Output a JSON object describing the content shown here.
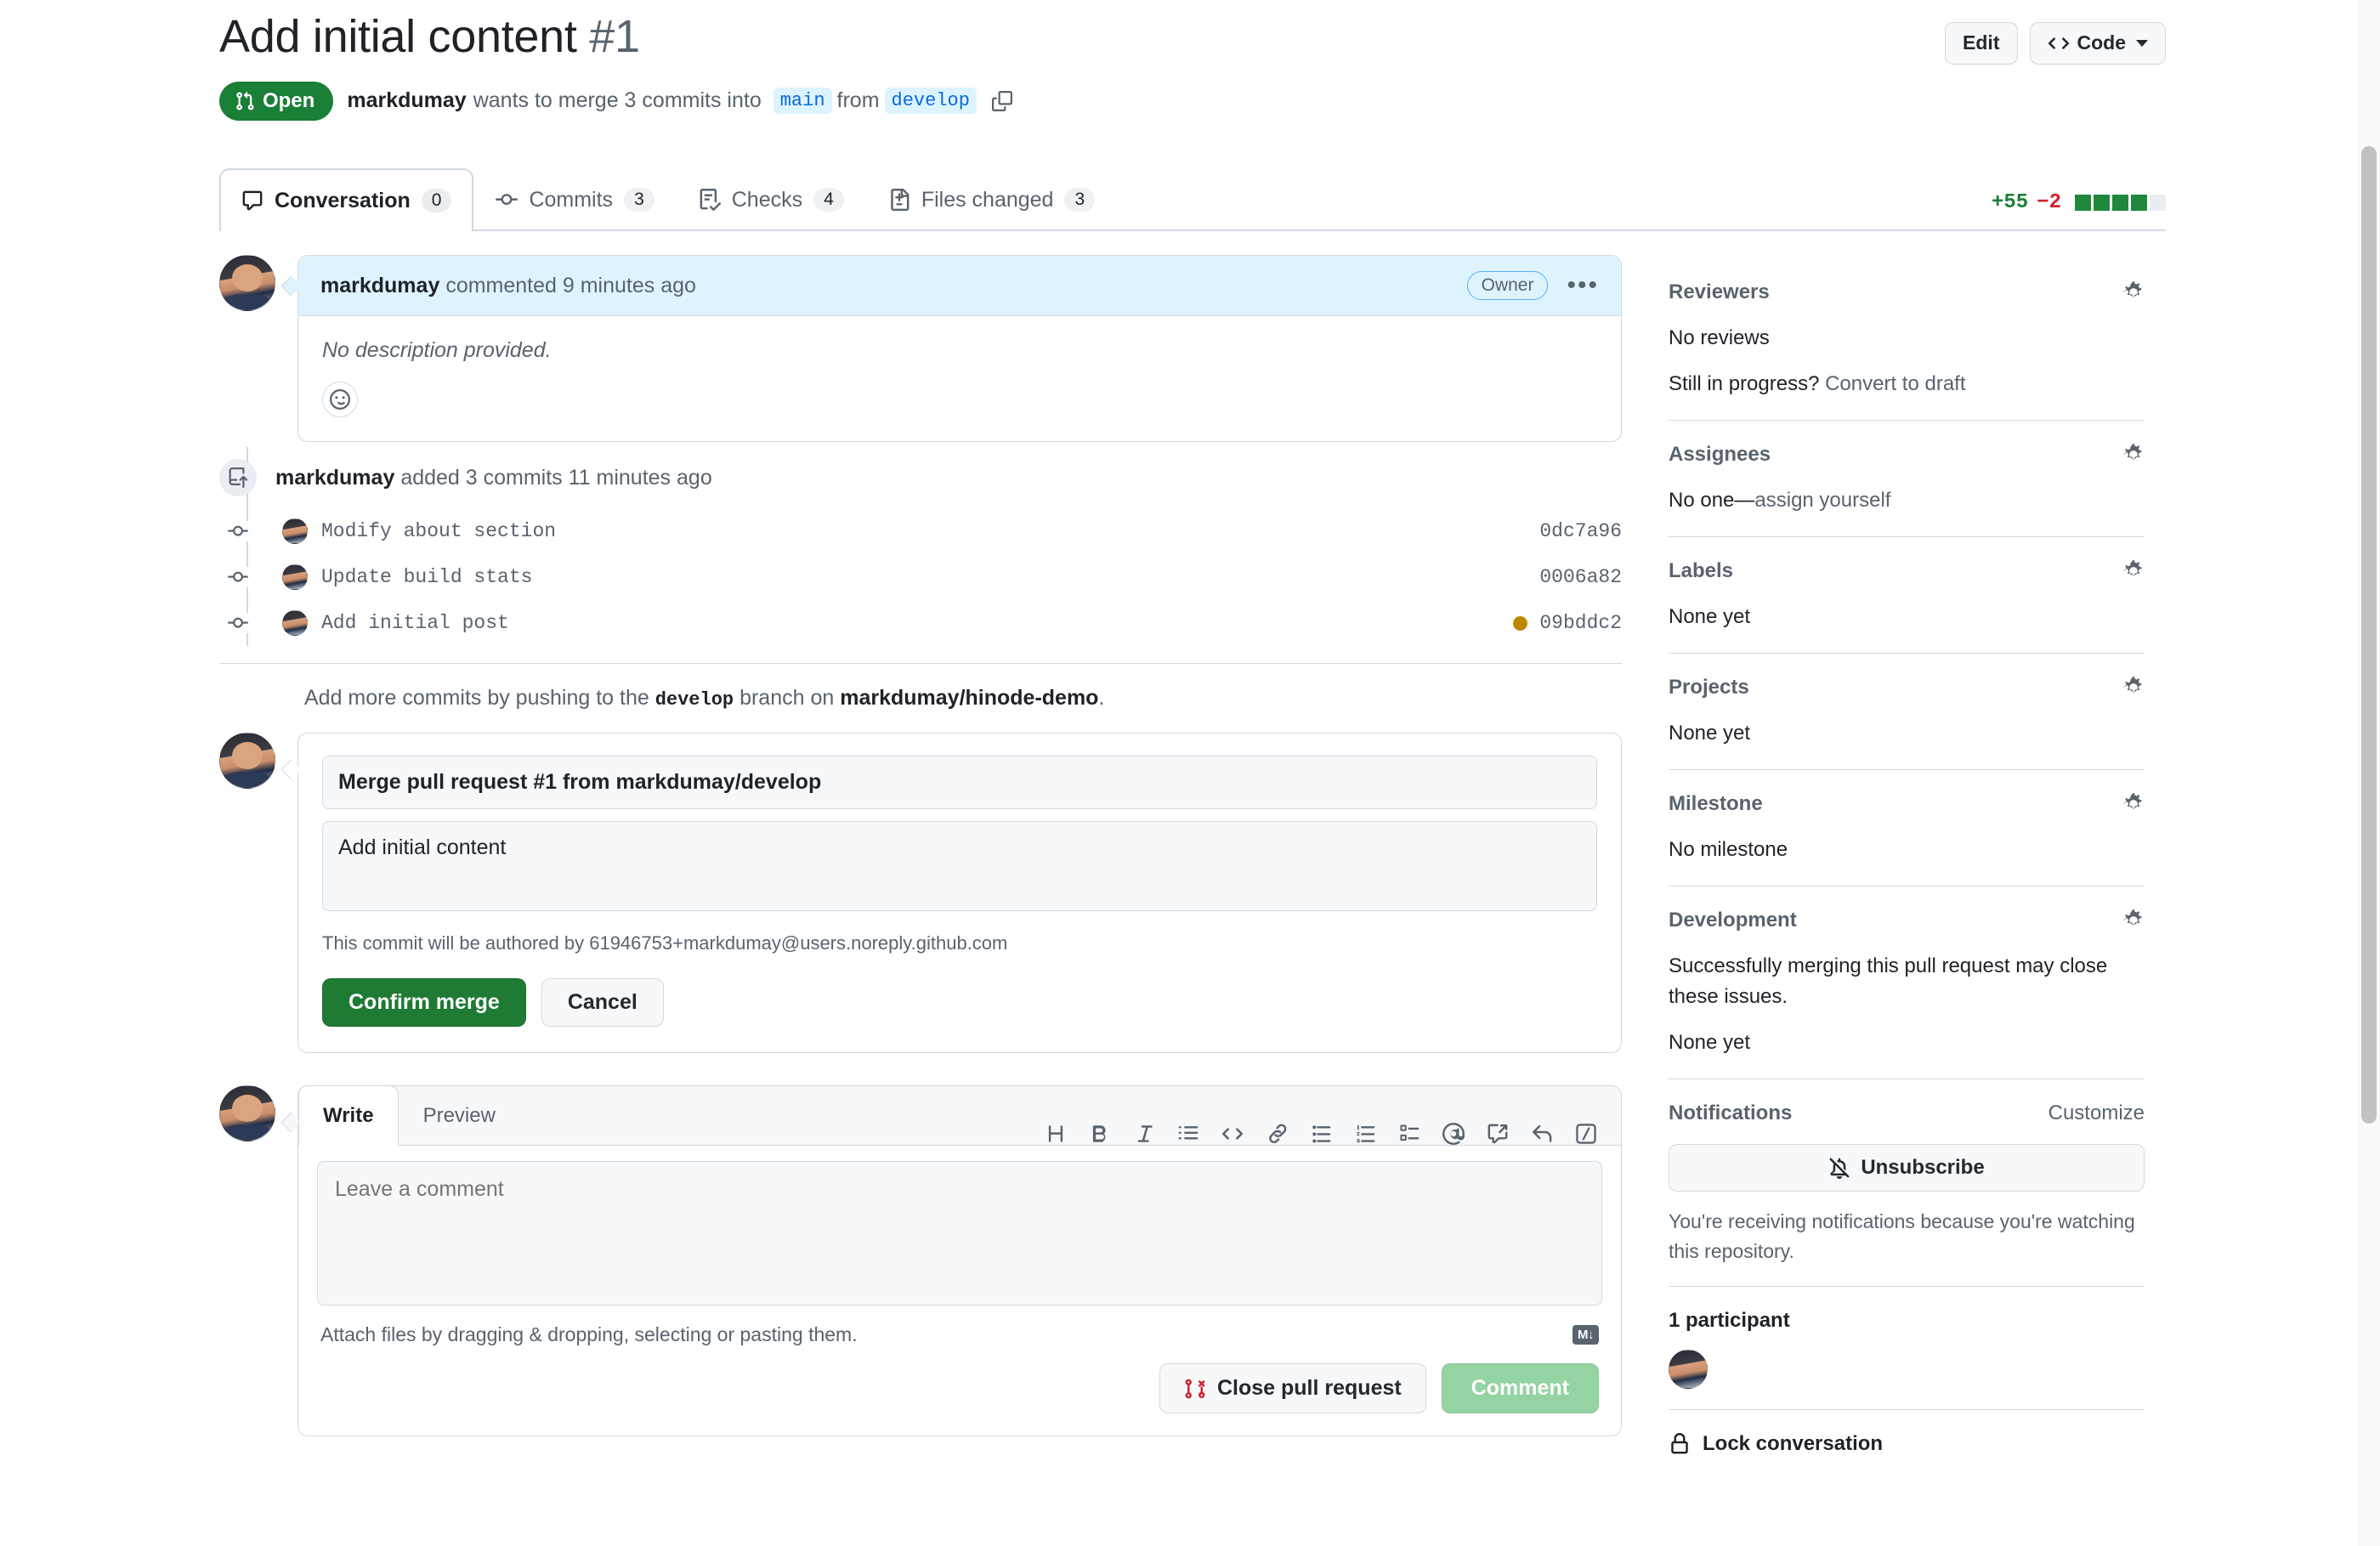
{
  "header": {
    "title": "Add initial content",
    "number": "#1",
    "edit_label": "Edit",
    "code_label": "Code",
    "state": "Open",
    "author": "markdumay",
    "merge_text_1": "wants to merge 3 commits into",
    "base_branch": "main",
    "merge_text_2": "from",
    "head_branch": "develop"
  },
  "tabs": [
    {
      "label": "Conversation",
      "count": "0",
      "icon": "comment-icon",
      "active": true
    },
    {
      "label": "Commits",
      "count": "3",
      "icon": "commit-icon",
      "active": false
    },
    {
      "label": "Checks",
      "count": "4",
      "icon": "checklist-icon",
      "active": false
    },
    {
      "label": "Files changed",
      "count": "3",
      "icon": "file-diff-icon",
      "active": false
    }
  ],
  "diffstat": {
    "additions": "+55",
    "deletions": "−2",
    "blocks": [
      "g",
      "g",
      "g",
      "g",
      "n"
    ],
    "add_color": "#1a7f37",
    "del_color": "#cf222e"
  },
  "comment": {
    "author": "markdumay",
    "action": "commented 9 minutes ago",
    "role_badge": "Owner",
    "body": "No description provided.",
    "header_bg": "#ddf4ff"
  },
  "timeline": {
    "push_author": "markdumay",
    "push_action": "added 3 commits 11 minutes ago",
    "commits": [
      {
        "message": "Modify about section",
        "sha": "0dc7a96",
        "status": ""
      },
      {
        "message": "Update build stats",
        "sha": "0006a82",
        "status": ""
      },
      {
        "message": "Add initial post",
        "sha": "09bddc2",
        "status": "pending"
      }
    ],
    "status_pending_color": "#bf8700",
    "add_more_prefix": "Add more commits by pushing to the",
    "add_more_branch": "develop",
    "add_more_middle": "branch on",
    "add_more_repo": "markdumay/hinode-demo",
    "add_more_suffix": "."
  },
  "merge_form": {
    "commit_title": "Merge pull request #1 from markdumay/develop",
    "commit_description": "Add initial content",
    "authored_note": "This commit will be authored by 61946753+markdumay@users.noreply.github.com",
    "confirm_label": "Confirm merge",
    "cancel_label": "Cancel",
    "confirm_color": "#1f7a33"
  },
  "editor": {
    "write_tab": "Write",
    "preview_tab": "Preview",
    "placeholder": "Leave a comment",
    "attach_note": "Attach files by dragging & dropping, selecting or pasting them.",
    "markdown_badge": "M↓",
    "toolbar": [
      {
        "name": "heading-icon",
        "glyph": "H"
      },
      {
        "name": "bold-icon",
        "glyph": "B"
      },
      {
        "name": "italic-icon",
        "glyph": "I"
      },
      {
        "name": "quote-icon",
        "glyph": "”"
      },
      {
        "name": "code-icon",
        "glyph": "<>"
      },
      {
        "name": "link-icon",
        "glyph": "🔗"
      },
      {
        "name": "unordered-list-icon",
        "glyph": "☰"
      },
      {
        "name": "ordered-list-icon",
        "glyph": "☰"
      },
      {
        "name": "task-list-icon",
        "glyph": "☑"
      },
      {
        "name": "mention-icon",
        "glyph": "@"
      },
      {
        "name": "reference-icon",
        "glyph": "↗"
      },
      {
        "name": "reply-icon",
        "glyph": "↩"
      },
      {
        "name": "slash-command-icon",
        "glyph": "/"
      }
    ],
    "close_pr_label": "Close pull request",
    "comment_label": "Comment",
    "comment_disabled_color": "#94d3a2"
  },
  "sidebar": {
    "reviewers": {
      "title": "Reviewers",
      "value": "No reviews",
      "progress_prefix": "Still in progress?",
      "progress_link": "Convert to draft"
    },
    "assignees": {
      "title": "Assignees",
      "value_prefix": "No one—",
      "value_link": "assign yourself"
    },
    "labels": {
      "title": "Labels",
      "value": "None yet"
    },
    "projects": {
      "title": "Projects",
      "value": "None yet"
    },
    "milestone": {
      "title": "Milestone",
      "value": "No milestone"
    },
    "development": {
      "title": "Development",
      "note": "Successfully merging this pull request may close these issues.",
      "value": "None yet"
    },
    "notifications": {
      "title": "Notifications",
      "customize": "Customize",
      "unsubscribe": "Unsubscribe",
      "note": "You're receiving notifications because you're watching this repository."
    },
    "participants": {
      "title": "1 participant"
    },
    "lock": {
      "label": "Lock conversation"
    }
  }
}
